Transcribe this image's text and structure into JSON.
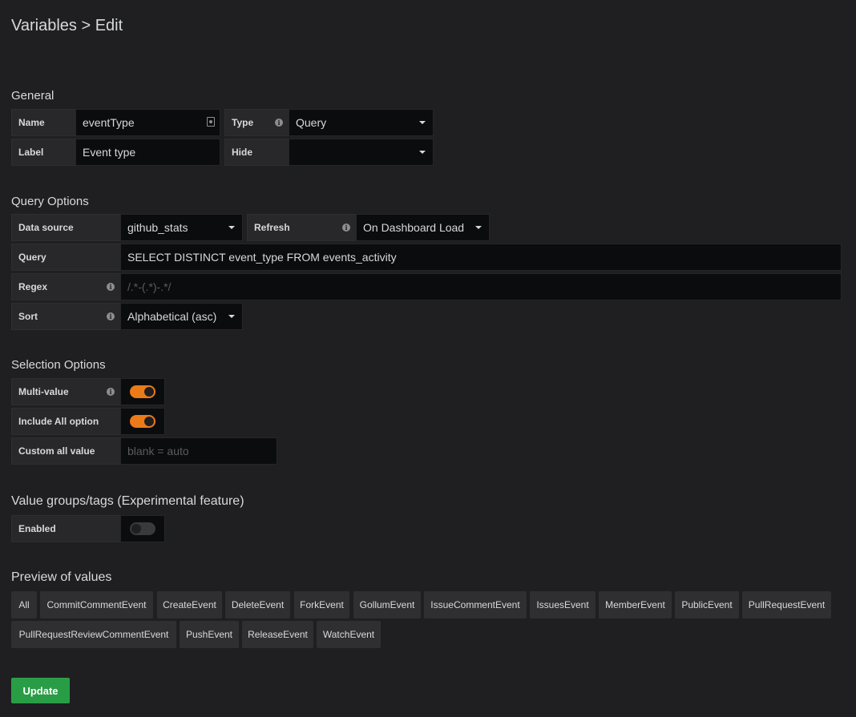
{
  "page": {
    "title": "Variables > Edit"
  },
  "general": {
    "heading": "General",
    "name_label": "Name",
    "name_value": "eventType",
    "type_label": "Type",
    "type_value": "Query",
    "label_label": "Label",
    "label_value": "Event type",
    "hide_label": "Hide",
    "hide_value": ""
  },
  "query_options": {
    "heading": "Query Options",
    "datasource_label": "Data source",
    "datasource_value": "github_stats",
    "refresh_label": "Refresh",
    "refresh_value": "On Dashboard Load",
    "query_label": "Query",
    "query_value": "SELECT DISTINCT event_type FROM events_activity",
    "regex_label": "Regex",
    "regex_placeholder": "/.*-(.*)-.*/",
    "sort_label": "Sort",
    "sort_value": "Alphabetical (asc)"
  },
  "selection_options": {
    "heading": "Selection Options",
    "multi_label": "Multi-value",
    "multi_on": true,
    "include_all_label": "Include All option",
    "include_all_on": true,
    "custom_all_label": "Custom all value",
    "custom_all_placeholder": "blank = auto"
  },
  "value_groups": {
    "heading": "Value groups/tags (Experimental feature)",
    "enabled_label": "Enabled",
    "enabled_on": false
  },
  "preview": {
    "heading": "Preview of values",
    "values": [
      "All",
      "CommitCommentEvent",
      "CreateEvent",
      "DeleteEvent",
      "ForkEvent",
      "GollumEvent",
      "IssueCommentEvent",
      "IssuesEvent",
      "MemberEvent",
      "PublicEvent",
      "PullRequestEvent",
      "PullRequestReviewCommentEvent",
      "PushEvent",
      "ReleaseEvent",
      "WatchEvent"
    ]
  },
  "actions": {
    "update_label": "Update"
  },
  "colors": {
    "accent": "#eb7b18",
    "success": "#299c46",
    "background": "#1f1f22"
  }
}
